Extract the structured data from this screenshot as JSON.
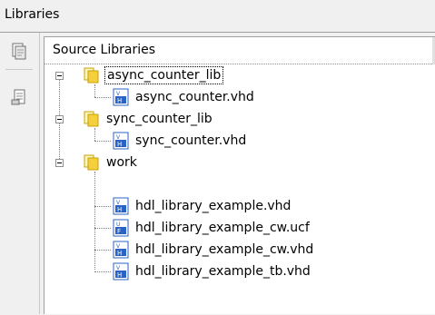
{
  "window": {
    "title": "Libraries"
  },
  "panel": {
    "header": "Source Libraries"
  },
  "tree": {
    "libraries": [
      {
        "name": "async_counter_lib",
        "expanded": true,
        "selected": true,
        "files": [
          {
            "name": "async_counter.vhd",
            "type": "vhd"
          }
        ]
      },
      {
        "name": "sync_counter_lib",
        "expanded": true,
        "selected": false,
        "files": [
          {
            "name": "sync_counter.vhd",
            "type": "vhd"
          }
        ]
      },
      {
        "name": "work",
        "expanded": true,
        "selected": false,
        "files": [
          {
            "name": "hdl_library_example.vhd",
            "type": "vhd"
          },
          {
            "name": "hdl_library_example_cw.ucf",
            "type": "ucf"
          },
          {
            "name": "hdl_library_example_cw.vhd",
            "type": "vhd"
          },
          {
            "name": "hdl_library_example_tb.vhd",
            "type": "vhd"
          }
        ]
      }
    ]
  },
  "icons": {
    "toolbar": [
      "add-source-icon",
      "library-properties-icon"
    ],
    "library": "library-folder-icon",
    "vhd": "vhdl-file-icon",
    "ucf": "ucf-file-icon",
    "expanded": "collapse-icon"
  },
  "colors": {
    "folder": "#f5cf3c",
    "file_blue": "#2a63c4"
  }
}
